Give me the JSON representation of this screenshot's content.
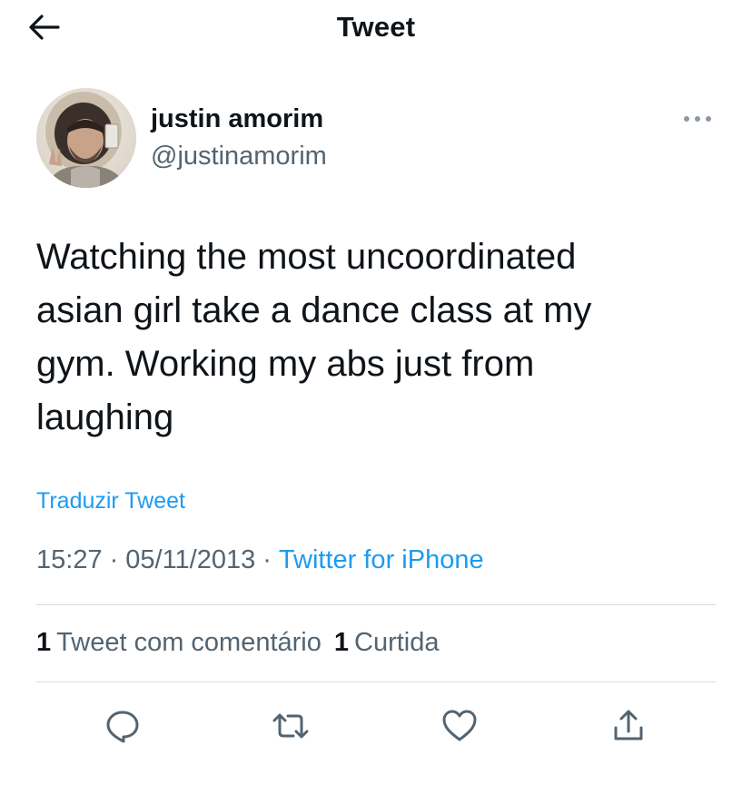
{
  "header": {
    "title": "Tweet",
    "back_icon": "arrow-left-icon"
  },
  "author": {
    "name": "justin amorim",
    "handle": "@justinamorim",
    "more_icon": "more-horizontal-icon"
  },
  "tweet": {
    "text": "Watching the most uncoordinated\nasian girl take a dance class at my\ngym. Working my abs just from\nlaughing",
    "translate_label": "Traduzir Tweet",
    "time": "15:27",
    "date": "05/11/2013",
    "source": "Twitter for iPhone",
    "separator": "·"
  },
  "stats": {
    "quote_count": "1",
    "quote_label": "Tweet com comentário",
    "like_count": "1",
    "like_label": "Curtida"
  },
  "actions": {
    "reply_icon": "reply-icon",
    "retweet_icon": "retweet-icon",
    "like_icon": "heart-icon",
    "share_icon": "share-icon"
  },
  "colors": {
    "text": "#0f1419",
    "secondary": "#536471",
    "link": "#1d9bf0",
    "divider": "#d9dde1"
  }
}
